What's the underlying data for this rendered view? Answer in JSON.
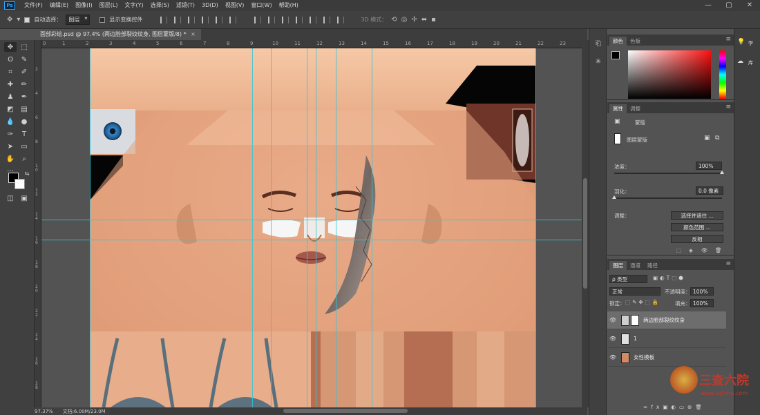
{
  "app": {
    "logo": "Ps"
  },
  "menu": [
    "文件(F)",
    "编辑(E)",
    "图像(I)",
    "图层(L)",
    "文字(Y)",
    "选择(S)",
    "滤镜(T)",
    "3D(D)",
    "视图(V)",
    "窗口(W)",
    "帮助(H)"
  ],
  "window_controls": [
    "—",
    "▢",
    "✕"
  ],
  "options_bar": {
    "auto_select_label": "自动选择：",
    "auto_select_value": "图层",
    "show_transform_label": "显示变换控件",
    "mode_3d_label": "3D 模式："
  },
  "document": {
    "tab_title": "面部彩绘.psd @ 97.4% (两边脸部裂纹纹身, 图层蒙版/8) *",
    "close_glyph": "×"
  },
  "rulers": {
    "top": [
      "0",
      "1",
      "2",
      "3",
      "4",
      "5",
      "6",
      "7",
      "8",
      "9",
      "10",
      "11",
      "12",
      "13",
      "14",
      "15",
      "16",
      "17",
      "18",
      "19",
      "20",
      "21",
      "22",
      "23"
    ],
    "left": [
      "2",
      "4",
      "6",
      "8",
      "1\n0",
      "1\n2",
      "1\n4",
      "1\n6",
      "1\n8",
      "2\n0",
      "2\n2",
      "2\n4",
      "2\n6",
      "2\n8"
    ]
  },
  "status": {
    "zoom": "97.37%",
    "doc_info": "文档:6.00M/23.0M"
  },
  "panels": {
    "color": {
      "tabs": [
        "颜色",
        "色板"
      ],
      "foreground": "#000000",
      "background": "#ffffff"
    },
    "properties": {
      "tabs": [
        "属性",
        "调整"
      ],
      "mask_type": "蒙版",
      "layer_mask_label": "图层蒙版",
      "density_label": "浓度：",
      "density_value": "100%",
      "density_level": 1.0,
      "feather_label": "羽化：",
      "feather_value": "0.0 像素",
      "feather_level": 0.0,
      "refine_label": "调整：",
      "btn_select_mask": "选择并遮住 ...",
      "btn_color_range": "颜色范围 ...",
      "btn_invert": "反相"
    },
    "layers": {
      "tabs": [
        "图层",
        "通道",
        "路径"
      ],
      "filter_label": "ρ 类型",
      "blend_mode": "正常",
      "opacity_label": "不透明度：",
      "opacity_value": "100%",
      "lock_label": "锁定：",
      "fill_label": "填充：",
      "fill_value": "100%",
      "items": [
        {
          "name": "两边脸部裂纹纹身",
          "selected": true
        },
        {
          "name": "1",
          "selected": false
        },
        {
          "name": "女性模板",
          "selected": false
        }
      ]
    }
  },
  "learn_panel": {
    "items": [
      "学",
      "库"
    ]
  },
  "watermark": {
    "text": "三查六院",
    "url": "www.sgtyhp.com"
  },
  "colors": {
    "guide": "#33c6d8",
    "skin": "#e2a17c",
    "panel_bg": "#535353"
  }
}
